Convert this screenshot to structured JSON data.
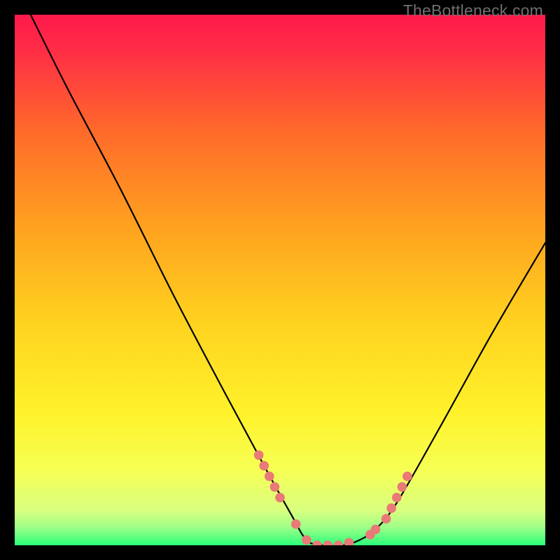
{
  "watermark": "TheBottleneck.com",
  "colors": {
    "background": "#000000",
    "gradient_top": "#ff1a4a",
    "gradient_upper_mid": "#ff8a1f",
    "gradient_mid": "#ffd21f",
    "gradient_lower_mid": "#ffff3a",
    "gradient_near_bottom": "#e8ff7a",
    "gradient_bottom": "#2dff7a",
    "curve": "#000000",
    "dot": "#e97a77"
  },
  "chart_data": {
    "type": "line",
    "title": "",
    "xlabel": "",
    "ylabel": "",
    "xlim": [
      0,
      100
    ],
    "ylim": [
      0,
      100
    ],
    "grid": false,
    "series": [
      {
        "name": "bottleneck-curve",
        "comment": "Estimated V-shaped bottleneck curve. y=0 at the optimal point; higher y = worse match.",
        "x": [
          3,
          10,
          20,
          30,
          40,
          47,
          52,
          55,
          58,
          62,
          65,
          68,
          72,
          80,
          90,
          100
        ],
        "y": [
          100,
          86,
          67,
          47,
          28,
          15,
          6,
          1,
          0,
          0,
          1,
          3,
          8,
          22,
          40,
          57
        ]
      }
    ],
    "dots": {
      "comment": "Highlighted near-zero-bottleneck markers on the curve (approximate % positions).",
      "points": [
        {
          "x": 46,
          "y": 17
        },
        {
          "x": 47,
          "y": 15
        },
        {
          "x": 48,
          "y": 13
        },
        {
          "x": 49,
          "y": 11
        },
        {
          "x": 50,
          "y": 9
        },
        {
          "x": 53,
          "y": 4
        },
        {
          "x": 55,
          "y": 1
        },
        {
          "x": 57,
          "y": 0
        },
        {
          "x": 59,
          "y": 0
        },
        {
          "x": 61,
          "y": 0
        },
        {
          "x": 63,
          "y": 0.5
        },
        {
          "x": 67,
          "y": 2
        },
        {
          "x": 68,
          "y": 3
        },
        {
          "x": 70,
          "y": 5
        },
        {
          "x": 71,
          "y": 7
        },
        {
          "x": 72,
          "y": 9
        },
        {
          "x": 73,
          "y": 11
        },
        {
          "x": 74,
          "y": 13
        }
      ],
      "radius_pct": 0.9
    }
  }
}
